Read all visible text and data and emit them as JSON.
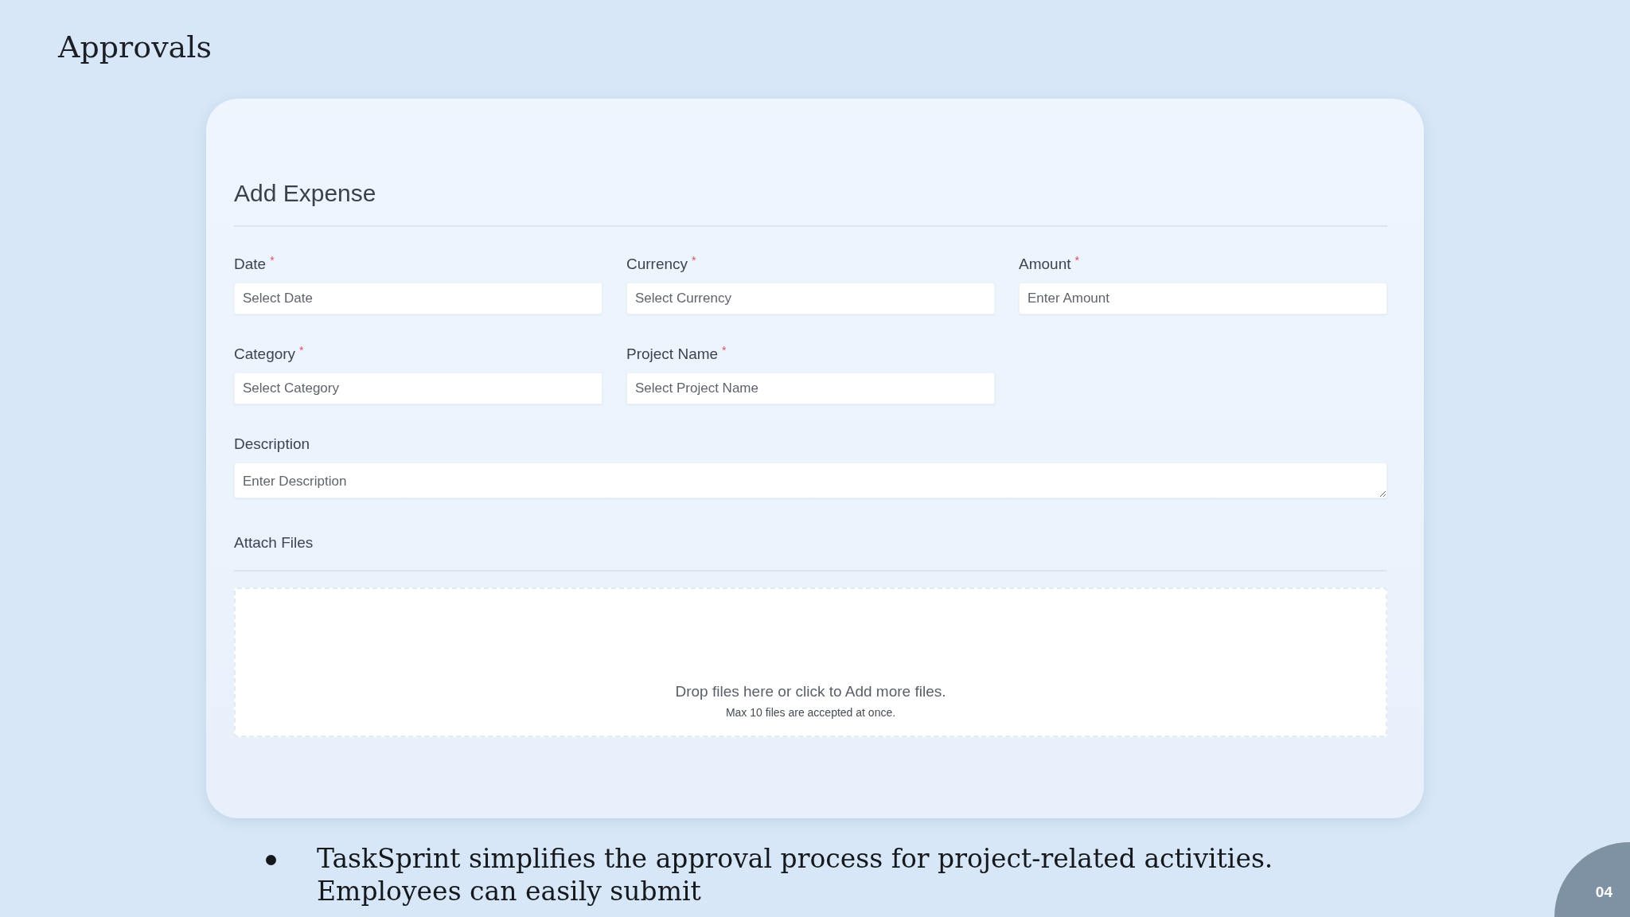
{
  "slide": {
    "title": "Approvals",
    "page_number": "04"
  },
  "form": {
    "title": "Add Expense",
    "rows": [
      {
        "fields": [
          {
            "kind": "input",
            "label": "Date",
            "required_mark": "*",
            "placeholder": "Select Date"
          },
          {
            "kind": "input",
            "label": "Currency",
            "required_mark": "*",
            "placeholder": "Select Currency"
          },
          {
            "kind": "input",
            "label": "Amount",
            "required_mark": "*",
            "placeholder": "Enter Amount"
          }
        ]
      },
      {
        "fields": [
          {
            "kind": "input",
            "label": "Category",
            "required_mark": "*",
            "placeholder": "Select Category"
          },
          {
            "kind": "input",
            "label": "Project Name",
            "required_mark": "*",
            "placeholder": "Select Project Name"
          }
        ]
      },
      {
        "fields": [
          {
            "kind": "textarea",
            "label": "Description",
            "placeholder": "Enter Description"
          }
        ]
      }
    ],
    "attachments": {
      "label": "Attach Files",
      "dropzone": {
        "prompt": "Drop files here or click to Add more files.",
        "note": "Max 10 files are accepted at once."
      }
    }
  },
  "bullets": [
    {
      "text": "TaskSprint simplifies the approval process for project-related activities. Employees can easily submit"
    }
  ]
}
